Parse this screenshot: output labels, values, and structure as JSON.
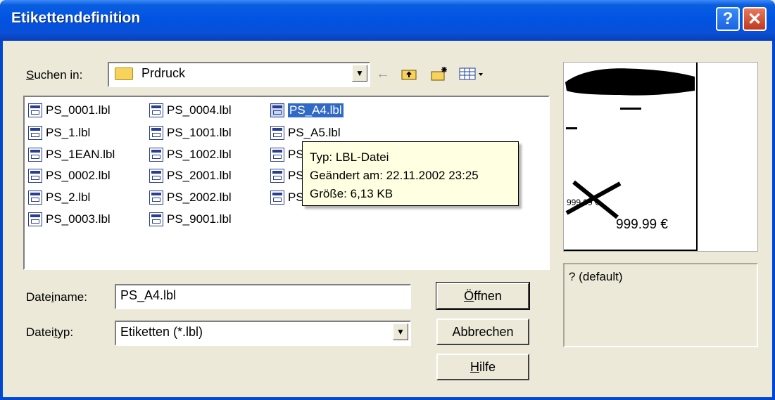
{
  "window": {
    "title": "Etikettendefinition",
    "help_glyph": "?",
    "close_glyph": "✕"
  },
  "lookin": {
    "label_pre": "",
    "label_u": "S",
    "label_post": "uchen in:",
    "value": "Prdruck"
  },
  "files": [
    {
      "name": "PS_0001.lbl",
      "selected": false
    },
    {
      "name": "PS_1.lbl",
      "selected": false
    },
    {
      "name": "PS_1EAN.lbl",
      "selected": false
    },
    {
      "name": "PS_0002.lbl",
      "selected": false
    },
    {
      "name": "PS_2.lbl",
      "selected": false
    },
    {
      "name": "PS_0003.lbl",
      "selected": false
    },
    {
      "name": "PS_0004.lbl",
      "selected": false
    },
    {
      "name": "PS_1001.lbl",
      "selected": false
    },
    {
      "name": "PS_1002.lbl",
      "selected": false
    },
    {
      "name": "PS_2001.lbl",
      "selected": false
    },
    {
      "name": "PS_2002.lbl",
      "selected": false
    },
    {
      "name": "PS_9001.lbl",
      "selected": false
    },
    {
      "name": "PS_A4.lbl",
      "selected": true
    },
    {
      "name": "PS_A5.lbl",
      "selected": false
    },
    {
      "name": "PS",
      "selected": false
    },
    {
      "name": "PS",
      "selected": false
    },
    {
      "name": "PS",
      "selected": false
    }
  ],
  "tooltip": {
    "type": "Typ: LBL-Datei",
    "modified": "Geändert am: 22.11.2002 23:25",
    "size": "Größe: 6,13 KB"
  },
  "filename": {
    "label_pre": "Date",
    "label_u": "i",
    "label_post": "name:",
    "value": "PS_A4.lbl"
  },
  "filetype": {
    "label_pre": "Datei",
    "label_u": "t",
    "label_post": "yp:",
    "value": "Etiketten (*.lbl)"
  },
  "buttons": {
    "open": {
      "u": "Ö",
      "rest": "ffnen"
    },
    "cancel": "Abbrechen",
    "help": {
      "u": "H",
      "rest": "ilfe"
    }
  },
  "preview": {
    "price_old": "999.99 €",
    "price_new": "999.99 €",
    "description": "? (default)"
  }
}
